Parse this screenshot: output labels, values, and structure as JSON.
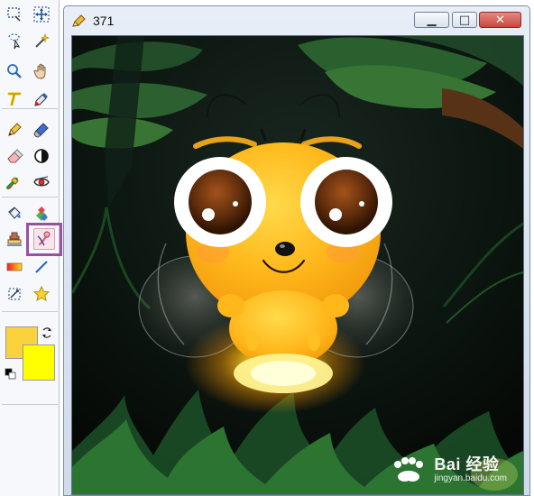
{
  "window": {
    "title": "371"
  },
  "toolbox": {
    "tools": [
      {
        "name": "select-rect-tool",
        "icon": "rectangle-select-icon"
      },
      {
        "name": "move-selection-tool",
        "icon": "move-icon"
      },
      {
        "name": "lasso-select-tool",
        "icon": "lasso-icon"
      },
      {
        "name": "magic-wand-tool",
        "icon": "magic-wand-icon"
      },
      {
        "name": "zoom-tool",
        "icon": "zoom-icon"
      },
      {
        "name": "pan-tool",
        "icon": "hand-icon"
      },
      {
        "name": "text-tool",
        "icon": "text-icon"
      },
      {
        "name": "color-picker-tool",
        "icon": "eyedropper-icon"
      },
      {
        "name": "pencil-tool",
        "icon": "pencil-icon"
      },
      {
        "name": "brush-tool",
        "icon": "brush-icon"
      },
      {
        "name": "eraser-tool",
        "icon": "eraser-icon"
      },
      {
        "name": "contrast-tool",
        "icon": "contrast-icon"
      },
      {
        "name": "smudge-tool",
        "icon": "smudge-icon"
      },
      {
        "name": "red-eye-tool",
        "icon": "eye-icon"
      },
      {
        "name": "bucket-tool",
        "icon": "paint-bucket-icon"
      },
      {
        "name": "recolor-tool",
        "icon": "recolor-icon"
      },
      {
        "name": "clone-stamp-tool",
        "icon": "clone-stamp-icon"
      },
      {
        "name": "retouch-tool",
        "icon": "retouch-icon"
      },
      {
        "name": "gradient-tool",
        "icon": "gradient-icon"
      },
      {
        "name": "line-tool",
        "icon": "line-icon"
      },
      {
        "name": "transform-tool",
        "icon": "transform-icon"
      },
      {
        "name": "shape-tool",
        "icon": "star-icon"
      }
    ],
    "active_tool": "retouch-tool",
    "primary_color": "#f9d23d",
    "secondary_color": "#ffff00"
  },
  "canvas": {
    "image": "firefly-bee-illustration"
  },
  "watermark": {
    "main_text": "Bai 经验",
    "sub_text": "jingyan.baidu.com"
  }
}
